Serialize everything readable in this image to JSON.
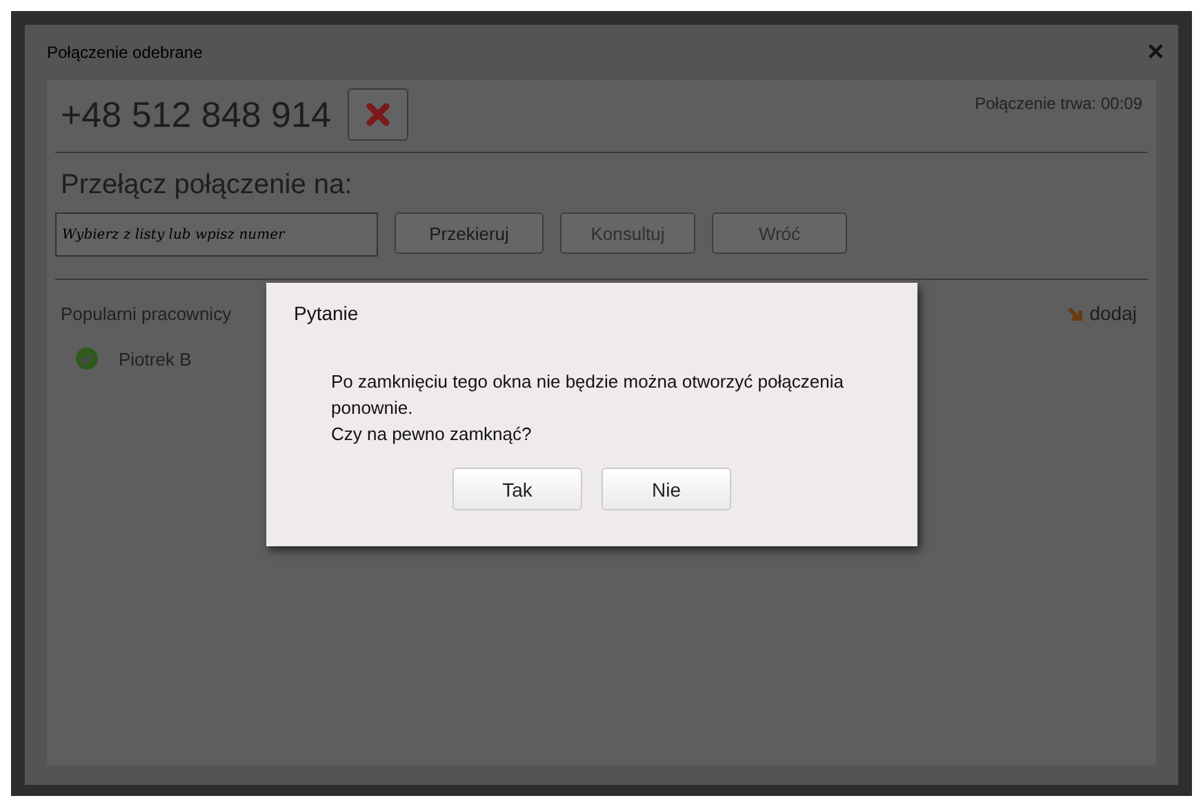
{
  "window": {
    "title": "Połączenie odebrane",
    "close": "✕"
  },
  "call": {
    "number": "+48 512 848 914",
    "duration": "Połączenie trwa: 00:09"
  },
  "transfer": {
    "heading": "Przełącz połączenie na:",
    "placeholder": "Wybierz z listy lub wpisz numer",
    "buttons": [
      {
        "label": "Przekieruj",
        "disabled": false
      },
      {
        "label": "Konsultuj",
        "disabled": true
      },
      {
        "label": "Wróć",
        "disabled": true
      }
    ]
  },
  "employees": {
    "heading": "Popularni pracownicy",
    "add": "dodaj",
    "items": [
      {
        "name": "Piotrek B",
        "available": true
      }
    ]
  },
  "dialog": {
    "title": "Pytanie",
    "message": "Po zamknięciu tego okna nie będzie można otworzyć połączenia ponownie.\nCzy na pewno zamknąć?",
    "buttons": [
      "Tak",
      "Nie"
    ]
  }
}
